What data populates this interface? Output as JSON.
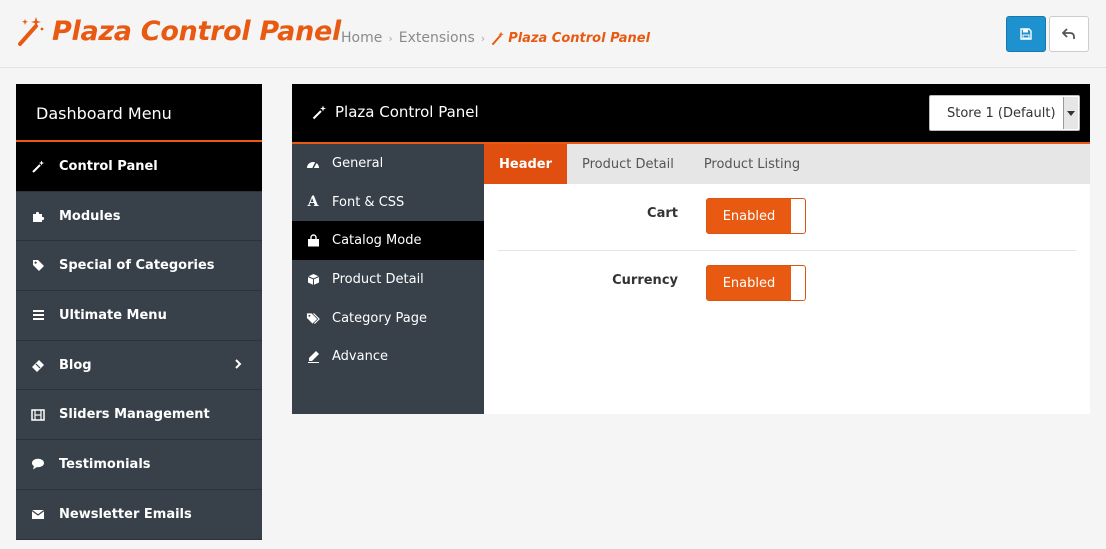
{
  "header": {
    "title": "Plaza Control Panel",
    "breadcrumb": [
      "Home",
      "Extensions",
      "Plaza Control Panel"
    ],
    "brand_color": "#e85a12"
  },
  "toolbar": {
    "save_icon": "floppy-disk-icon",
    "back_icon": "reply-arrow-icon"
  },
  "sidebar": {
    "title": "Dashboard Menu",
    "items": [
      {
        "label": "Control Panel",
        "icon": "magic-wand-icon",
        "active": true
      },
      {
        "label": "Modules",
        "icon": "puzzle-icon"
      },
      {
        "label": "Special of Categories",
        "icon": "tag-icon"
      },
      {
        "label": "Ultimate Menu",
        "icon": "bars-icon"
      },
      {
        "label": "Blog",
        "icon": "ticket-icon",
        "has_submenu": true
      },
      {
        "label": "Sliders Management",
        "icon": "film-icon"
      },
      {
        "label": "Testimonials",
        "icon": "comment-icon"
      },
      {
        "label": "Newsletter Emails",
        "icon": "envelope-icon"
      }
    ]
  },
  "panel": {
    "title": "Plaza Control Panel",
    "store_select": "Store 1 (Default)",
    "subnav": [
      {
        "label": "General",
        "icon": "dashboard-icon"
      },
      {
        "label": "Font & CSS",
        "icon": "font-icon"
      },
      {
        "label": "Catalog Mode",
        "icon": "shopping-bag-icon",
        "active": true
      },
      {
        "label": "Product Detail",
        "icon": "cube-icon"
      },
      {
        "label": "Category Page",
        "icon": "tags-icon"
      },
      {
        "label": "Advance",
        "icon": "eyedropper-icon"
      }
    ],
    "tabs": [
      {
        "label": "Header",
        "active": true
      },
      {
        "label": "Product Detail"
      },
      {
        "label": "Product Listing"
      }
    ],
    "settings": [
      {
        "label": "Cart",
        "value": "Enabled"
      },
      {
        "label": "Currency",
        "value": "Enabled"
      }
    ]
  }
}
